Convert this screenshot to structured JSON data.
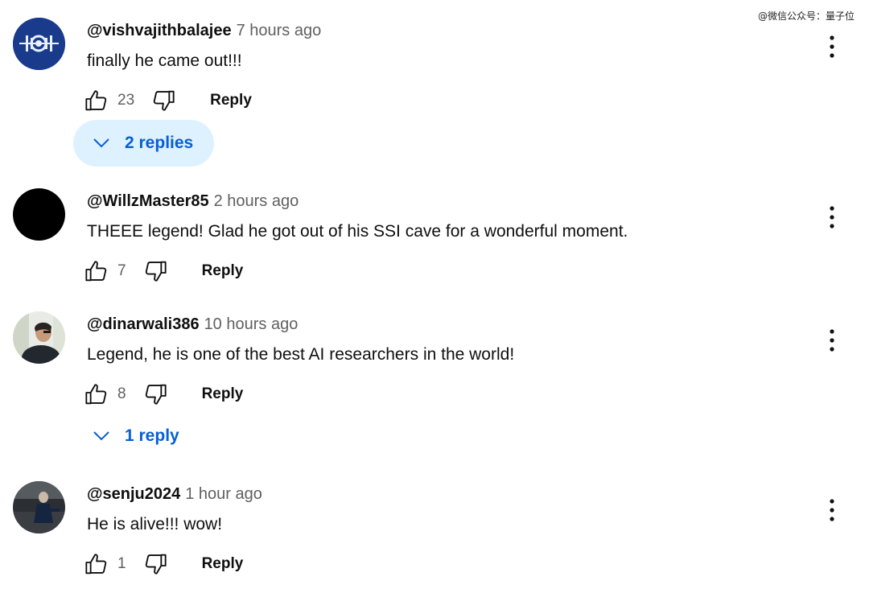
{
  "watermark": "@微信公众号：量子位",
  "comments": [
    {
      "author": "@vishvajithbalajee",
      "time": "7 hours ago",
      "text": "finally he came out!!!",
      "likes": "23",
      "reply_label": "Reply",
      "replies_toggle": "2 replies",
      "avatar_icon": "space-station-icon",
      "avatar_bg": "#1a3a8c"
    },
    {
      "author": "@WillzMaster85",
      "time": "2 hours ago",
      "text": "THEEE legend! Glad he got out of his SSI cave for a wonderful moment.",
      "likes": "7",
      "reply_label": "Reply",
      "avatar_bg": "#000000"
    },
    {
      "author": "@dinarwali386",
      "time": "10 hours ago",
      "text": "Legend, he is one of the best AI researchers in the world!",
      "likes": "8",
      "reply_label": "Reply",
      "replies_toggle": "1 reply",
      "avatar_icon": "person-photo"
    },
    {
      "author": "@senju2024",
      "time": "1 hour ago",
      "text": "He is alive!!! wow!",
      "likes": "1",
      "reply_label": "Reply",
      "avatar_icon": "person-photo"
    }
  ],
  "colors": {
    "link_blue": "#065fd4",
    "toggle_bg": "#def1ff",
    "meta_gray": "#606060"
  }
}
